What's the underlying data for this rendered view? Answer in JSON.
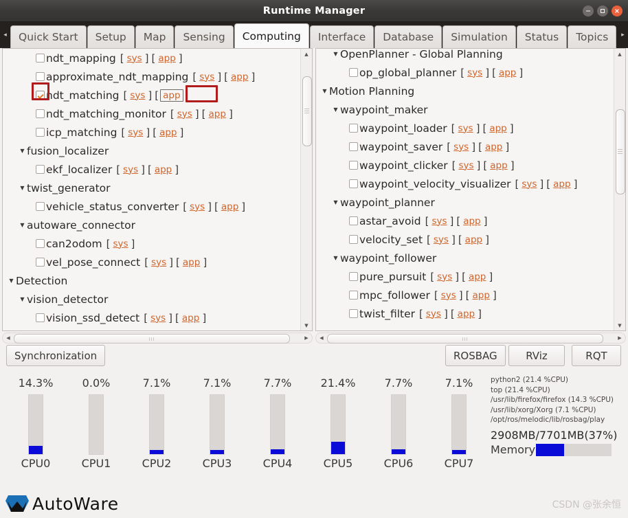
{
  "window": {
    "title": "Runtime Manager",
    "buttons": {
      "minimize": "minimize-icon",
      "maximize": "maximize-icon",
      "close": "close-icon"
    }
  },
  "tabs": {
    "scroll_left": "◂",
    "scroll_right": "▸",
    "items": [
      {
        "label": "Quick Start",
        "active": false
      },
      {
        "label": "Setup",
        "active": false
      },
      {
        "label": "Map",
        "active": false
      },
      {
        "label": "Sensing",
        "active": false
      },
      {
        "label": "Computing",
        "active": true
      },
      {
        "label": "Interface",
        "active": false
      },
      {
        "label": "Database",
        "active": false
      },
      {
        "label": "Simulation",
        "active": false
      },
      {
        "label": "Status",
        "active": false
      },
      {
        "label": "Topics",
        "active": false
      }
    ]
  },
  "left_panel": {
    "rows": [
      {
        "indent": 2,
        "kind": "leaf",
        "checked": false,
        "label": "ndt_mapping",
        "links": [
          "sys",
          "app"
        ]
      },
      {
        "indent": 2,
        "kind": "leaf",
        "checked": false,
        "label": "approximate_ndt_mapping",
        "links": [
          "sys",
          "app"
        ]
      },
      {
        "indent": 2,
        "kind": "leaf",
        "checked": true,
        "label": "ndt_matching",
        "links": [
          "sys",
          "app"
        ],
        "highlight_checkbox": true,
        "highlight_app": true
      },
      {
        "indent": 2,
        "kind": "leaf",
        "checked": false,
        "label": "ndt_matching_monitor",
        "links": [
          "sys",
          "app"
        ]
      },
      {
        "indent": 2,
        "kind": "leaf",
        "checked": false,
        "label": "icp_matching",
        "links": [
          "sys",
          "app"
        ]
      },
      {
        "indent": 1,
        "kind": "group",
        "label": "fusion_localizer"
      },
      {
        "indent": 2,
        "kind": "leaf",
        "checked": false,
        "label": "ekf_localizer",
        "links": [
          "sys",
          "app"
        ]
      },
      {
        "indent": 1,
        "kind": "group",
        "label": "twist_generator"
      },
      {
        "indent": 2,
        "kind": "leaf",
        "checked": false,
        "label": "vehicle_status_converter",
        "links": [
          "sys",
          "app"
        ]
      },
      {
        "indent": 1,
        "kind": "group",
        "label": "autoware_connector"
      },
      {
        "indent": 2,
        "kind": "leaf",
        "checked": false,
        "label": "can2odom",
        "links": [
          "sys"
        ]
      },
      {
        "indent": 2,
        "kind": "leaf",
        "checked": false,
        "label": "vel_pose_connect",
        "links": [
          "sys",
          "app"
        ]
      },
      {
        "indent": 0,
        "kind": "group",
        "label": "Detection"
      },
      {
        "indent": 1,
        "kind": "group",
        "label": "vision_detector"
      },
      {
        "indent": 2,
        "kind": "leaf",
        "checked": false,
        "label": "vision_ssd_detect",
        "links": [
          "sys",
          "app"
        ]
      }
    ]
  },
  "right_panel": {
    "rows": [
      {
        "indent": 1,
        "kind": "group",
        "label": "OpenPlanner - Global Planning"
      },
      {
        "indent": 2,
        "kind": "leaf",
        "checked": false,
        "label": "op_global_planner",
        "links": [
          "sys",
          "app"
        ]
      },
      {
        "indent": 0,
        "kind": "group",
        "label": "Motion Planning"
      },
      {
        "indent": 1,
        "kind": "group",
        "label": "waypoint_maker"
      },
      {
        "indent": 2,
        "kind": "leaf",
        "checked": false,
        "label": "waypoint_loader",
        "links": [
          "sys",
          "app"
        ]
      },
      {
        "indent": 2,
        "kind": "leaf",
        "checked": false,
        "label": "waypoint_saver",
        "links": [
          "sys",
          "app"
        ]
      },
      {
        "indent": 2,
        "kind": "leaf",
        "checked": false,
        "label": "waypoint_clicker",
        "links": [
          "sys",
          "app"
        ]
      },
      {
        "indent": 2,
        "kind": "leaf",
        "checked": false,
        "label": "waypoint_velocity_visualizer",
        "links": [
          "sys",
          "app"
        ]
      },
      {
        "indent": 1,
        "kind": "group",
        "label": "waypoint_planner"
      },
      {
        "indent": 2,
        "kind": "leaf",
        "checked": false,
        "label": "astar_avoid",
        "links": [
          "sys",
          "app"
        ]
      },
      {
        "indent": 2,
        "kind": "leaf",
        "checked": false,
        "label": "velocity_set",
        "links": [
          "sys",
          "app"
        ]
      },
      {
        "indent": 1,
        "kind": "group",
        "label": "waypoint_follower"
      },
      {
        "indent": 2,
        "kind": "leaf",
        "checked": false,
        "label": "pure_pursuit",
        "links": [
          "sys",
          "app"
        ]
      },
      {
        "indent": 2,
        "kind": "leaf",
        "checked": false,
        "label": "mpc_follower",
        "links": [
          "sys",
          "app"
        ]
      },
      {
        "indent": 2,
        "kind": "leaf",
        "checked": false,
        "label": "twist_filter",
        "links": [
          "sys",
          "app"
        ]
      }
    ]
  },
  "buttons": {
    "synchronization": "Synchronization",
    "rosbag": "ROSBAG",
    "rviz": "RViz",
    "rqt": "RQT"
  },
  "chart_data": {
    "type": "bar",
    "title": "CPU usage per core",
    "categories": [
      "CPU0",
      "CPU1",
      "CPU2",
      "CPU3",
      "CPU4",
      "CPU5",
      "CPU6",
      "CPU7"
    ],
    "values": [
      14.3,
      0.0,
      7.1,
      7.1,
      7.7,
      21.4,
      7.7,
      7.1
    ],
    "value_labels": [
      "14.3%",
      "0.0%",
      "7.1%",
      "7.1%",
      "7.7%",
      "21.4%",
      "7.7%",
      "7.1%"
    ],
    "ylim": [
      0,
      100
    ],
    "ylabel": "",
    "xlabel": "",
    "grid": false,
    "legend": "none",
    "bar_color": "#0b0bd8",
    "track_color": "#d9d6d3"
  },
  "processes": {
    "lines": [
      "python2 (21.4 %CPU)",
      "top (21.4 %CPU)",
      "/usr/lib/firefox/firefox (14.3 %CPU)",
      "/usr/lib/xorg/Xorg (7.1 %CPU)",
      "/opt/ros/melodic/lib/rosbag/play"
    ]
  },
  "memory": {
    "text": "2908MB/7701MB(37%)",
    "label": "Memory",
    "percent": 37,
    "used_mb": 2908,
    "total_mb": 7701
  },
  "footer": {
    "logo_text": "AutoWare",
    "watermark": "CSDN @张余恒"
  },
  "colors": {
    "accent_link": "#d1642a",
    "annotation": "#b01c1c",
    "bar": "#0b0bd8",
    "titlebar": "#3b3937"
  }
}
